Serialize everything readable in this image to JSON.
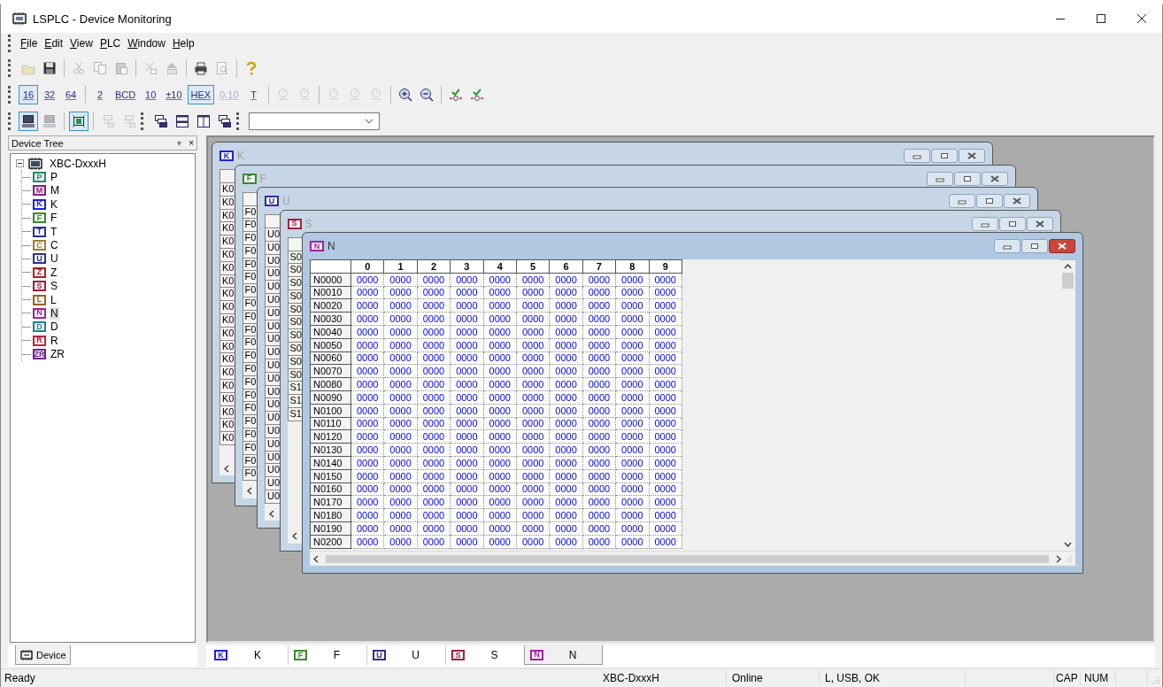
{
  "window": {
    "title": "LSPLC - Device Monitoring"
  },
  "menu": [
    {
      "label": "File"
    },
    {
      "label": "Edit"
    },
    {
      "label": "View"
    },
    {
      "label": "PLC"
    },
    {
      "label": "Window"
    },
    {
      "label": "Help"
    }
  ],
  "toolbars": [
    {
      "items": [
        {
          "kind": "icon",
          "selected": false,
          "disabled": true
        },
        {
          "kind": "icon",
          "selected": false,
          "disabled": false
        },
        {
          "kind": "separator"
        },
        {
          "kind": "icon",
          "selected": false,
          "disabled": true
        },
        {
          "kind": "icon",
          "selected": false,
          "disabled": true
        },
        {
          "kind": "icon",
          "selected": false,
          "disabled": true
        },
        {
          "kind": "separator"
        },
        {
          "kind": "icon",
          "selected": false,
          "disabled": true
        },
        {
          "kind": "icon",
          "selected": false,
          "disabled": true
        },
        {
          "kind": "separator"
        },
        {
          "kind": "icon",
          "selected": false,
          "disabled": false
        },
        {
          "kind": "icon",
          "selected": false,
          "disabled": true
        },
        {
          "kind": "separator"
        },
        {
          "kind": "icon",
          "selected": false,
          "disabled": false
        }
      ]
    },
    {
      "items": [
        {
          "kind": "text",
          "label": "16",
          "selected": true,
          "disabled": false
        },
        {
          "kind": "text",
          "label": "32",
          "selected": false,
          "disabled": false
        },
        {
          "kind": "text",
          "label": "64",
          "selected": false,
          "disabled": false
        },
        {
          "kind": "separator"
        },
        {
          "kind": "text",
          "label": "2",
          "selected": false,
          "disabled": false
        },
        {
          "kind": "text",
          "label": "BCD",
          "selected": false,
          "disabled": false
        },
        {
          "kind": "text",
          "label": "10",
          "selected": false,
          "disabled": false
        },
        {
          "kind": "text",
          "label": "±10",
          "selected": false,
          "disabled": false
        },
        {
          "kind": "text",
          "label": "HEX",
          "selected": true,
          "disabled": false
        },
        {
          "kind": "text",
          "label": "0.10",
          "selected": false,
          "disabled": true
        },
        {
          "kind": "text",
          "label": "T",
          "selected": false,
          "disabled": false
        },
        {
          "kind": "separator"
        },
        {
          "kind": "icon",
          "selected": false,
          "disabled": true
        },
        {
          "kind": "icon",
          "selected": false,
          "disabled": true
        },
        {
          "kind": "separator"
        },
        {
          "kind": "icon",
          "selected": false,
          "disabled": true
        },
        {
          "kind": "icon",
          "selected": false,
          "disabled": true
        },
        {
          "kind": "icon",
          "selected": false,
          "disabled": true
        },
        {
          "kind": "separator"
        },
        {
          "kind": "icon",
          "selected": false,
          "disabled": false
        },
        {
          "kind": "icon",
          "selected": false,
          "disabled": false
        },
        {
          "kind": "separator"
        },
        {
          "kind": "icon",
          "selected": false,
          "disabled": false
        },
        {
          "kind": "icon",
          "selected": false,
          "disabled": false
        }
      ]
    },
    {
      "items": [
        {
          "kind": "icon",
          "selected": true,
          "disabled": false
        },
        {
          "kind": "icon",
          "selected": false,
          "disabled": true
        },
        {
          "kind": "separator"
        },
        {
          "kind": "icon",
          "selected": true,
          "disabled": false
        },
        {
          "kind": "separator"
        },
        {
          "kind": "icon",
          "selected": false,
          "disabled": true
        },
        {
          "kind": "icon",
          "selected": false,
          "disabled": true
        },
        {
          "kind": "grip"
        },
        {
          "kind": "icon",
          "selected": false,
          "disabled": false
        },
        {
          "kind": "icon",
          "selected": false,
          "disabled": false
        },
        {
          "kind": "icon",
          "selected": false,
          "disabled": false
        },
        {
          "kind": "icon",
          "selected": false,
          "disabled": false
        },
        {
          "kind": "grip"
        },
        {
          "kind": "dropdown"
        }
      ]
    }
  ],
  "device_tree": {
    "title": "Device Tree",
    "pin": "▾",
    "close": "×",
    "root": {
      "label": "XBC-DxxxH",
      "expanded": true,
      "children": [
        {
          "badge": "P",
          "label": "P",
          "color": "#1f8a6a",
          "selected": false
        },
        {
          "badge": "M",
          "label": "M",
          "color": "#8a1a8a",
          "selected": false
        },
        {
          "badge": "K",
          "label": "K",
          "color": "#2020e0",
          "selected": false
        },
        {
          "badge": "F",
          "label": "F",
          "color": "#3a8a2a",
          "selected": false
        },
        {
          "badge": "T",
          "label": "T",
          "color": "#3030a0",
          "selected": false
        },
        {
          "badge": "C",
          "label": "C",
          "color": "#a08030",
          "selected": false
        },
        {
          "badge": "U",
          "label": "U",
          "color": "#303090",
          "selected": false
        },
        {
          "badge": "Z",
          "label": "Z",
          "color": "#b02020",
          "selected": false
        },
        {
          "badge": "S",
          "label": "S",
          "color": "#a02040",
          "selected": false
        },
        {
          "badge": "L",
          "label": "L",
          "color": "#a06020",
          "selected": false
        },
        {
          "badge": "N",
          "label": "N",
          "color": "#a020a0",
          "selected": true
        },
        {
          "badge": "D",
          "label": "D",
          "color": "#208090",
          "selected": false
        },
        {
          "badge": "R",
          "label": "R",
          "color": "#c02040",
          "selected": false
        },
        {
          "badge": "ZR",
          "label": "ZR",
          "color": "#702090",
          "selected": false
        }
      ]
    }
  },
  "panel_tabs": [
    {
      "label": "Device",
      "selected": true
    }
  ],
  "mdi_windows": [
    {
      "kind": "column",
      "title": "K",
      "badge": "K",
      "color": "#2020e0",
      "active": false,
      "row_labels": [
        "K0",
        "K0",
        "K0",
        "K0",
        "K0",
        "K0",
        "K0",
        "K0",
        "K0",
        "K0",
        "K0",
        "K0",
        "K0",
        "K0",
        "K0",
        "K0",
        "K0",
        "K0",
        "K0",
        "K0"
      ]
    },
    {
      "kind": "column",
      "title": "F",
      "badge": "F",
      "color": "#3a8a2a",
      "active": false,
      "row_labels": [
        "F0",
        "F0",
        "F0",
        "F0",
        "F0",
        "F0",
        "F0",
        "F0",
        "F0",
        "F0",
        "F0",
        "F0",
        "F0",
        "F0",
        "F0",
        "F0",
        "F0",
        "F0",
        "F0",
        "F0",
        "F0"
      ]
    },
    {
      "kind": "column",
      "title": "U",
      "badge": "U",
      "color": "#303090",
      "active": false,
      "row_labels": [
        "U0",
        "U0",
        "U0",
        "U0",
        "U0",
        "U0",
        "U0",
        "U0",
        "U0",
        "U0",
        "U0",
        "U0",
        "U0",
        "U0",
        "U0",
        "U0",
        "U0",
        "U0",
        "U0",
        "U0",
        "U0"
      ]
    },
    {
      "kind": "column",
      "title": "S",
      "badge": "S",
      "color": "#a02040",
      "active": false,
      "row_labels": [
        "S0",
        "S0",
        "S0",
        "S0",
        "S0",
        "S0",
        "S0",
        "S0",
        "S0",
        "S0",
        "S1",
        "S1",
        "S1"
      ]
    },
    {
      "kind": "table",
      "title": "N",
      "badge": "N",
      "color": "#a020a0",
      "active": true,
      "columns": [
        "0",
        "1",
        "2",
        "3",
        "4",
        "5",
        "6",
        "7",
        "8",
        "9"
      ],
      "rows": [
        {
          "label": "N0000",
          "cells": [
            "0000",
            "0000",
            "0000",
            "0000",
            "0000",
            "0000",
            "0000",
            "0000",
            "0000",
            "0000"
          ]
        },
        {
          "label": "N0010",
          "cells": [
            "0000",
            "0000",
            "0000",
            "0000",
            "0000",
            "0000",
            "0000",
            "0000",
            "0000",
            "0000"
          ]
        },
        {
          "label": "N0020",
          "cells": [
            "0000",
            "0000",
            "0000",
            "0000",
            "0000",
            "0000",
            "0000",
            "0000",
            "0000",
            "0000"
          ]
        },
        {
          "label": "N0030",
          "cells": [
            "0000",
            "0000",
            "0000",
            "0000",
            "0000",
            "0000",
            "0000",
            "0000",
            "0000",
            "0000"
          ]
        },
        {
          "label": "N0040",
          "cells": [
            "0000",
            "0000",
            "0000",
            "0000",
            "0000",
            "0000",
            "0000",
            "0000",
            "0000",
            "0000"
          ]
        },
        {
          "label": "N0050",
          "cells": [
            "0000",
            "0000",
            "0000",
            "0000",
            "0000",
            "0000",
            "0000",
            "0000",
            "0000",
            "0000"
          ]
        },
        {
          "label": "N0060",
          "cells": [
            "0000",
            "0000",
            "0000",
            "0000",
            "0000",
            "0000",
            "0000",
            "0000",
            "0000",
            "0000"
          ]
        },
        {
          "label": "N0070",
          "cells": [
            "0000",
            "0000",
            "0000",
            "0000",
            "0000",
            "0000",
            "0000",
            "0000",
            "0000",
            "0000"
          ]
        },
        {
          "label": "N0080",
          "cells": [
            "0000",
            "0000",
            "0000",
            "0000",
            "0000",
            "0000",
            "0000",
            "0000",
            "0000",
            "0000"
          ]
        },
        {
          "label": "N0090",
          "cells": [
            "0000",
            "0000",
            "0000",
            "0000",
            "0000",
            "0000",
            "0000",
            "0000",
            "0000",
            "0000"
          ]
        },
        {
          "label": "N0100",
          "cells": [
            "0000",
            "0000",
            "0000",
            "0000",
            "0000",
            "0000",
            "0000",
            "0000",
            "0000",
            "0000"
          ]
        },
        {
          "label": "N0110",
          "cells": [
            "0000",
            "0000",
            "0000",
            "0000",
            "0000",
            "0000",
            "0000",
            "0000",
            "0000",
            "0000"
          ]
        },
        {
          "label": "N0120",
          "cells": [
            "0000",
            "0000",
            "0000",
            "0000",
            "0000",
            "0000",
            "0000",
            "0000",
            "0000",
            "0000"
          ]
        },
        {
          "label": "N0130",
          "cells": [
            "0000",
            "0000",
            "0000",
            "0000",
            "0000",
            "0000",
            "0000",
            "0000",
            "0000",
            "0000"
          ]
        },
        {
          "label": "N0140",
          "cells": [
            "0000",
            "0000",
            "0000",
            "0000",
            "0000",
            "0000",
            "0000",
            "0000",
            "0000",
            "0000"
          ]
        },
        {
          "label": "N0150",
          "cells": [
            "0000",
            "0000",
            "0000",
            "0000",
            "0000",
            "0000",
            "0000",
            "0000",
            "0000",
            "0000"
          ]
        },
        {
          "label": "N0160",
          "cells": [
            "0000",
            "0000",
            "0000",
            "0000",
            "0000",
            "0000",
            "0000",
            "0000",
            "0000",
            "0000"
          ]
        },
        {
          "label": "N0170",
          "cells": [
            "0000",
            "0000",
            "0000",
            "0000",
            "0000",
            "0000",
            "0000",
            "0000",
            "0000",
            "0000"
          ]
        },
        {
          "label": "N0180",
          "cells": [
            "0000",
            "0000",
            "0000",
            "0000",
            "0000",
            "0000",
            "0000",
            "0000",
            "0000",
            "0000"
          ]
        },
        {
          "label": "N0190",
          "cells": [
            "0000",
            "0000",
            "0000",
            "0000",
            "0000",
            "0000",
            "0000",
            "0000",
            "0000",
            "0000"
          ]
        },
        {
          "label": "N0200",
          "cells": [
            "0000",
            "0000",
            "0000",
            "0000",
            "0000",
            "0000",
            "0000",
            "0000",
            "0000",
            "0000"
          ]
        }
      ]
    }
  ],
  "window_tabs": [
    {
      "badge": "K",
      "label": "K",
      "color": "#2020e0",
      "selected": false
    },
    {
      "badge": "F",
      "label": "F",
      "color": "#3a8a2a",
      "selected": false
    },
    {
      "badge": "U",
      "label": "U",
      "color": "#303090",
      "selected": false
    },
    {
      "badge": "S",
      "label": "S",
      "color": "#a02040",
      "selected": false
    },
    {
      "badge": "N",
      "label": "N",
      "color": "#a020a0",
      "selected": true
    }
  ],
  "status_bar": [
    "Ready",
    "XBC-DxxxH",
    "Online",
    "L, USB, OK",
    "CAP",
    "NUM"
  ]
}
